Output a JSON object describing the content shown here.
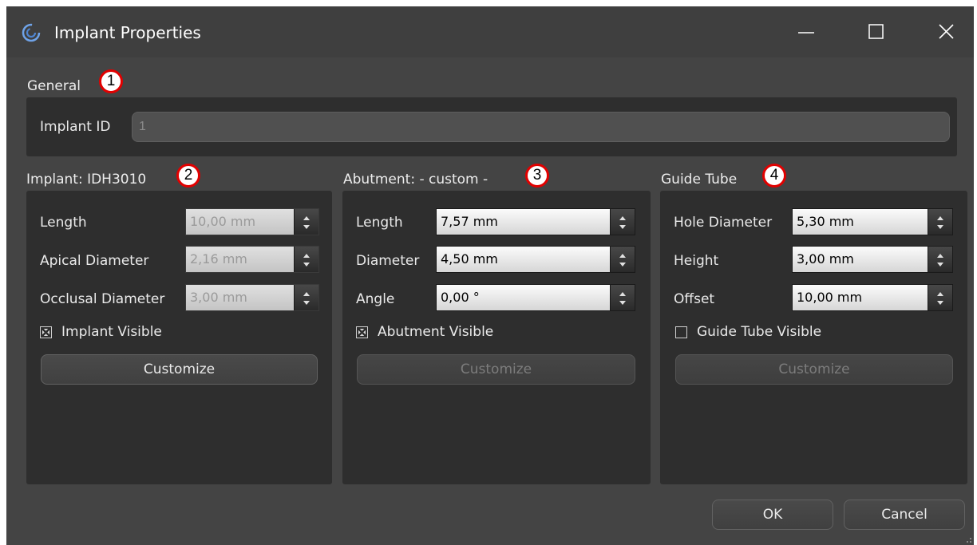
{
  "window": {
    "title": "Implant Properties",
    "app_icon": "swirl-icon",
    "controls": [
      "minimize-icon",
      "maximize-icon",
      "close-icon"
    ]
  },
  "general": {
    "label": "General",
    "badge": "1",
    "implant_id_label": "Implant ID",
    "implant_id_value": "1"
  },
  "implant": {
    "label": "Implant: IDH3010",
    "badge": "2",
    "length_label": "Length",
    "length_value": "10,00 mm",
    "apical_label": "Apical Diameter",
    "apical_value": "2,16 mm",
    "occlusal_label": "Occlusal Diameter",
    "occlusal_value": "3,00 mm",
    "visible_label": "Implant Visible",
    "visible_checked": true,
    "customize_label": "Customize"
  },
  "abutment": {
    "label": "Abutment: - custom -",
    "badge": "3",
    "length_label": "Length",
    "length_value": "7,57 mm",
    "diameter_label": "Diameter",
    "diameter_value": "4,50 mm",
    "angle_label": "Angle",
    "angle_value": "0,00 °",
    "visible_label": "Abutment Visible",
    "visible_checked": true,
    "customize_label": "Customize"
  },
  "guide_tube": {
    "label": "Guide Tube",
    "badge": "4",
    "hole_label": "Hole Diameter",
    "hole_value": "5,30 mm",
    "height_label": "Height",
    "height_value": "3,00 mm",
    "offset_label": "Offset",
    "offset_value": "10,00 mm",
    "visible_label": "Guide Tube Visible",
    "visible_checked": false,
    "customize_label": "Customize"
  },
  "footer": {
    "ok_label": "OK",
    "cancel_label": "Cancel"
  },
  "colors": {
    "window_bg": "#444444",
    "panel_bg": "#2e2e2e",
    "badge_border": "#e10000"
  }
}
